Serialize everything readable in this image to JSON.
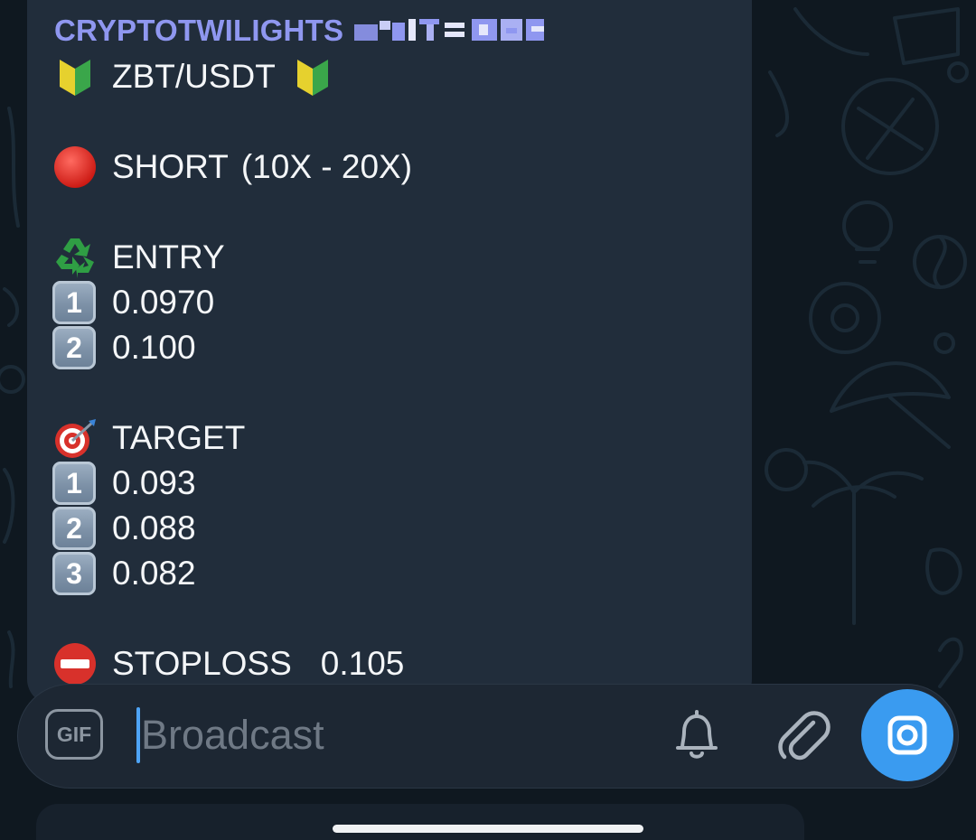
{
  "channel": {
    "sender_name": "CRYPTOTWILIGHTS",
    "sender_rank_obscured": true
  },
  "message": {
    "pair": "ZBT/USDT",
    "direction": "SHORT",
    "leverage": "(10X - 20X)",
    "entry_heading": "ENTRY",
    "entries": [
      {
        "num": "1",
        "value": "0.0970"
      },
      {
        "num": "2",
        "value": "0.100"
      }
    ],
    "target_heading": "TARGET",
    "targets": [
      {
        "num": "1",
        "value": "0.093"
      },
      {
        "num": "2",
        "value": "0.088"
      },
      {
        "num": "3",
        "value": "0.082"
      }
    ],
    "stoploss_label": "STOPLOSS",
    "stoploss_value": "0.105"
  },
  "composer": {
    "gif_label": "GIF",
    "placeholder": "Broadcast"
  },
  "icons": {
    "pair": "beginner-leaf-icon",
    "direction": "red-circle-icon",
    "entry": "recycle-icon",
    "target": "bullseye-dart-icon",
    "stoploss": "no-entry-icon",
    "notification": "bell-icon",
    "attach": "paperclip-icon",
    "camera": "camera-icon"
  },
  "colors": {
    "background": "#0f1820",
    "bubble": "#212d3b",
    "sender_name": "#8f97f0",
    "text": "#f4f6f8",
    "accent": "#3a9bf0",
    "placeholder": "#6f7985"
  }
}
